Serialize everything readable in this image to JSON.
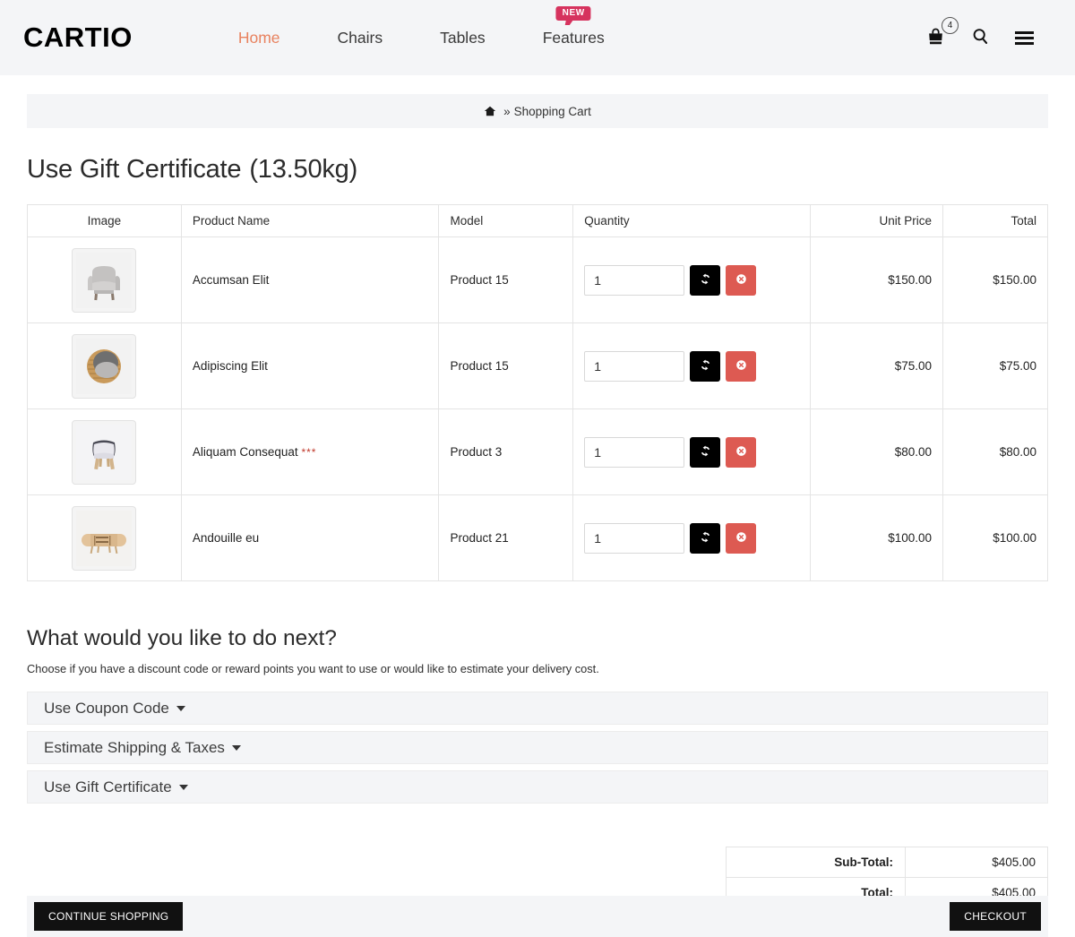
{
  "header": {
    "brand": "CARTIO",
    "nav": [
      {
        "label": "Home",
        "active": true,
        "badge": null
      },
      {
        "label": "Chairs",
        "active": false,
        "badge": null
      },
      {
        "label": "Tables",
        "active": false,
        "badge": null
      },
      {
        "label": "Features",
        "active": false,
        "badge": "NEW"
      }
    ],
    "cart_count": "4",
    "icons": {
      "cart": "shopping-bag-icon",
      "search": "search-icon",
      "menu": "hamburger-menu-icon"
    },
    "colors": {
      "accent": "#e8825f",
      "badge": "#d6335e",
      "header_bg": "#f4f5f7"
    }
  },
  "breadcrumb": {
    "home_icon": "home-icon",
    "separator": "»",
    "current": "Shopping Cart"
  },
  "page": {
    "title": "Use Gift Certificate",
    "weight": "(13.50kg)"
  },
  "cart": {
    "columns": [
      "Image",
      "Product Name",
      "Model",
      "Quantity",
      "Unit Price",
      "Total"
    ],
    "rows": [
      {
        "image": "armchair-grey-thumbnail",
        "name": "Accumsan Elit",
        "required_mark": "",
        "model": "Product 15",
        "quantity": "1",
        "unit_price": "$150.00",
        "total": "$150.00"
      },
      {
        "image": "round-wicker-chair-thumbnail",
        "name": "Adipiscing Elit",
        "required_mark": "",
        "model": "Product 15",
        "quantity": "1",
        "unit_price": "$75.00",
        "total": "$75.00"
      },
      {
        "image": "white-tub-chair-thumbnail",
        "name": "Aliquam Consequat",
        "required_mark": "***",
        "model": "Product 3",
        "quantity": "1",
        "unit_price": "$80.00",
        "total": "$80.00"
      },
      {
        "image": "wooden-sideboard-thumbnail",
        "name": "Andouille eu",
        "required_mark": "",
        "model": "Product 21",
        "quantity": "1",
        "unit_price": "$100.00",
        "total": "$100.00"
      }
    ],
    "row_buttons": {
      "refresh_icon": "refresh-icon",
      "remove_icon": "remove-circle-icon",
      "refresh_color": "#000000",
      "remove_color": "#dd5a52"
    }
  },
  "next_section": {
    "heading": "What would you like to do next?",
    "subtext": "Choose if you have a discount code or reward points you want to use or would like to estimate your delivery cost.",
    "panels": [
      {
        "label": "Use Coupon Code"
      },
      {
        "label": "Estimate Shipping & Taxes"
      },
      {
        "label": "Use Gift Certificate"
      }
    ]
  },
  "totals": [
    {
      "label": "Sub-Total:",
      "value": "$405.00"
    },
    {
      "label": "Total:",
      "value": "$405.00"
    }
  ],
  "actions": {
    "continue_shopping": "CONTINUE SHOPPING",
    "checkout": "CHECKOUT"
  }
}
